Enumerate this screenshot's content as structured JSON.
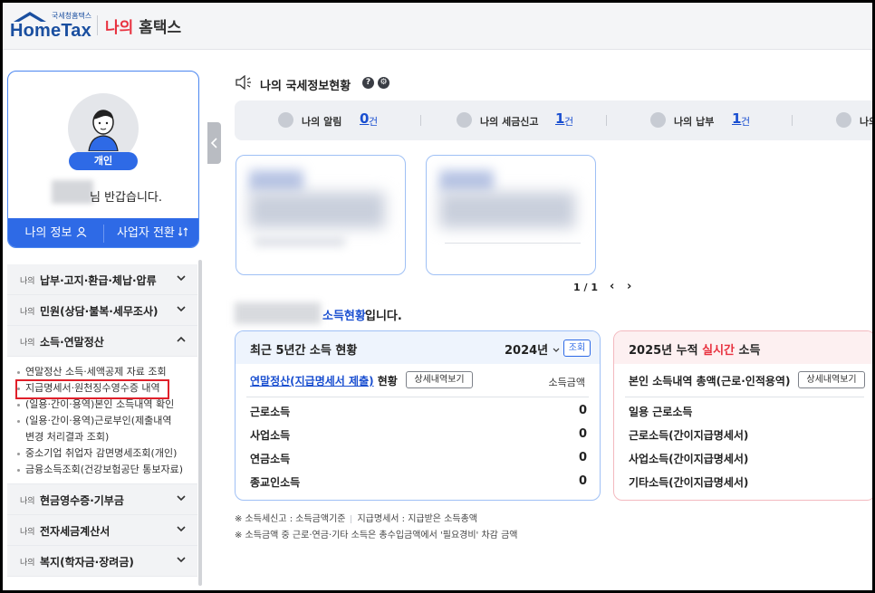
{
  "header": {
    "logo_small": "국세청홈택스",
    "logo_text": "HomeTax",
    "title_red": "나의",
    "title_rest": " 홈택스"
  },
  "profile": {
    "badge": "개인",
    "greeting": "님 반갑습니다.",
    "my_info": "나의 정보",
    "switch_business": "사업자 전환"
  },
  "sidebar": {
    "menu_prefix": "나의",
    "items": [
      {
        "label": "납부·고지·환급·체납·압류"
      },
      {
        "label": "민원(상담·불복·세무조사)"
      },
      {
        "label": "소득·연말정산"
      },
      {
        "label": "현금영수증·기부금"
      },
      {
        "label": "전자세금계산서"
      },
      {
        "label": "복지(학자금·장려금)"
      }
    ],
    "submenu": [
      "연말정산 소득·세액공제 자료 조회",
      "지급명세서·원천징수영수증 내역",
      "(일용·간이·용역)본인 소득내역 확인",
      "(일용·간이·용역)근로부인(제출내역",
      "변경 처리결과 조회)",
      "중소기업 취업자 감면명세조회(개인)",
      "금융소득조회(건강보험공단 통보자료)"
    ]
  },
  "main": {
    "section_title": "나의 국세정보현황",
    "notify": [
      {
        "label": "나의 알림",
        "count": "0",
        "unit": "건"
      },
      {
        "label": "나의 세금신고",
        "count": "1",
        "unit": "건"
      },
      {
        "label": "나의 납부",
        "count": "1",
        "unit": "건"
      },
      {
        "label": "나의"
      }
    ],
    "pager": {
      "text": "1 / 1",
      "prev": "‹",
      "next": "›"
    },
    "income_head_blue": "소득현황",
    "income_head_rest": " 입니다."
  },
  "left_panel": {
    "title": "최근 5년간 소득 현황",
    "year": "2024년",
    "query_btn": "조회",
    "row_title": "연말정산(지급명세서 제출)",
    "row_title_suffix": " 현황",
    "detail_btn": "상세내역보기",
    "col_label": "소득금액",
    "rows": [
      {
        "label": "근로소득",
        "value": "0"
      },
      {
        "label": "사업소득",
        "value": "0"
      },
      {
        "label": "연금소득",
        "value": "0"
      },
      {
        "label": "종교인소득",
        "value": "0"
      }
    ]
  },
  "right_panel": {
    "title_pre": "2025년 누적 ",
    "title_red": "실시간",
    "title_post": " 소득",
    "row_title": "본인 소득내역 총액(근로·인적용역)",
    "detail_btn": "상세내역보기",
    "rows": [
      {
        "label": "일용 근로소득"
      },
      {
        "label": "근로소득(간이지급명세서)"
      },
      {
        "label": "사업소득(간이지급명세서)"
      },
      {
        "label": "기타소득(간이지급명세서)"
      }
    ]
  },
  "notes": {
    "line1_a": "※ 소득세신고 : 소득금액기준",
    "line1_b": "지급명세서 : 지급받은 소득총액",
    "line2": "※ 소득금액 중 근로·연금·기타 소득은 총수입금액에서 '필요경비' 차감 금액"
  },
  "colors": {
    "accent": "#2e6ae6",
    "brand": "#1a4fa0",
    "red": "#e8313f"
  }
}
